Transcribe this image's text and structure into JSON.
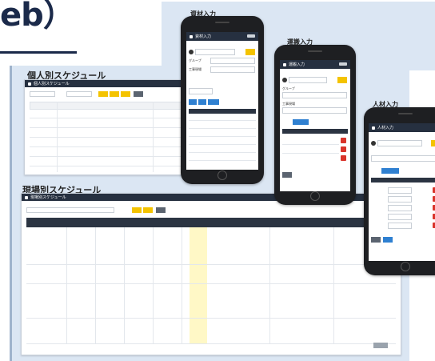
{
  "slide": {
    "title_fragment": "eb）"
  },
  "sections": {
    "personal": "個人別スケジュール",
    "site": "現場別スケジュール",
    "material": "資材入力",
    "transport": "運搬入力",
    "staff": "人材入力"
  },
  "personal_card": {
    "nav": "個人別スケジュール"
  },
  "site_card": {
    "nav": "現場別スケジュール"
  },
  "phones": {
    "material": {
      "nav": "資材入力",
      "group_label": "グループ",
      "site_label": "工事現場"
    },
    "transport": {
      "nav": "運搬入力",
      "group_label": "グループ",
      "site_label": "工事現場"
    },
    "staff": {
      "nav": "人材入力"
    }
  }
}
